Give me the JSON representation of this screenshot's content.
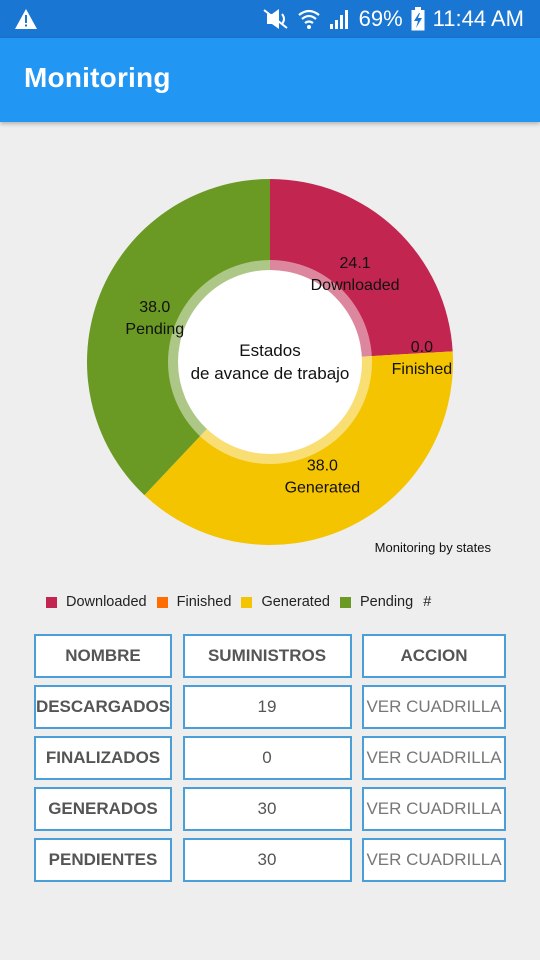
{
  "status_bar": {
    "icons": [
      "warning-icon",
      "mute-icon",
      "wifi-icon",
      "signal-icon",
      "battery-charging-icon"
    ],
    "battery": "69%",
    "time": "11:44 AM"
  },
  "app_bar": {
    "title": "Monitoring"
  },
  "chart_data": {
    "type": "pie",
    "center_text_line1": "Estados",
    "center_text_line2": "de avance de trabajo",
    "description": "Monitoring by states",
    "slices": [
      {
        "label": "Downloaded",
        "value": 24.1,
        "value_label": "24.1",
        "color": "#c2254f"
      },
      {
        "label": "Finished",
        "value": 0.0,
        "value_label": "0.0",
        "color": "#ff6d00"
      },
      {
        "label": "Generated",
        "value": 38.0,
        "value_label": "38.0",
        "color": "#f4c400"
      },
      {
        "label": "Pending",
        "value": 38.0,
        "value_label": "38.0",
        "color": "#6a9a23"
      }
    ],
    "legend": [
      "Downloaded",
      "Finished",
      "Generated",
      "Pending"
    ],
    "legend_suffix": "#"
  },
  "table": {
    "headers": [
      "NOMBRE",
      "SUMINISTROS",
      "ACCION"
    ],
    "rows": [
      {
        "name": "DESCARGADOS",
        "count": "19",
        "action": "VER CUADRILLA"
      },
      {
        "name": "FINALIZADOS",
        "count": "0",
        "action": "VER CUADRILLA"
      },
      {
        "name": "GENERADOS",
        "count": "30",
        "action": "VER CUADRILLA"
      },
      {
        "name": "PENDIENTES",
        "count": "30",
        "action": "VER CUADRILLA"
      }
    ]
  }
}
